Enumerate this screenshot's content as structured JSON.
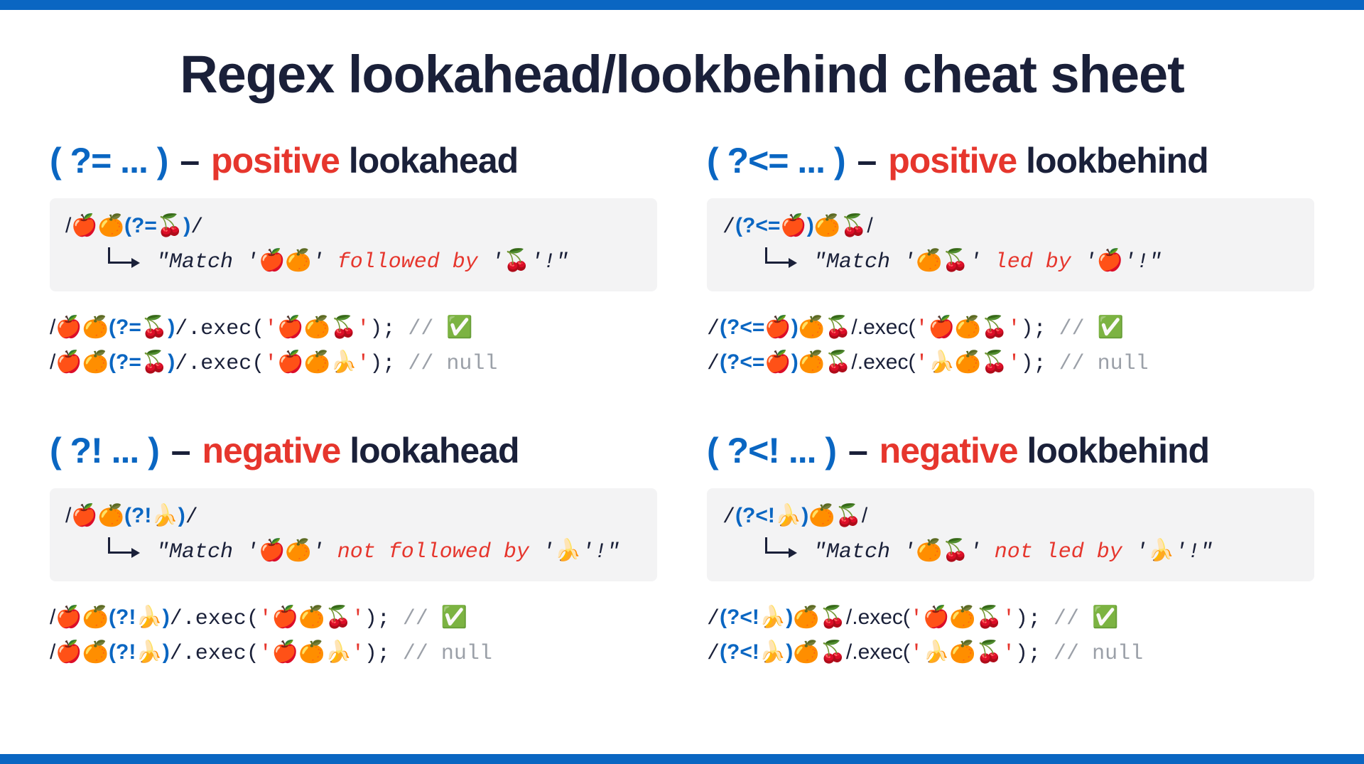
{
  "title": "Regex lookahead/lookbehind cheat sheet",
  "emoji": {
    "apple": "🍎",
    "orange": "🍊",
    "cherry": "🍒",
    "banana": "🍌",
    "check": "✅"
  },
  "panels": {
    "pos_ahead": {
      "syntax": "( ?= ... )",
      "dash": "–",
      "polarity": "positive",
      "kind": "lookahead",
      "pattern_pre": "/🍎🍊",
      "pattern_group": "(?=🍒)",
      "pattern_post": "/",
      "desc_pre": "\"Match '",
      "desc_subject": "🍎🍊",
      "desc_mid": "' ",
      "desc_condition": "followed by",
      "desc_post1": " '",
      "desc_target": "🍒",
      "desc_post2": "'!\"",
      "exec1": {
        "p_pre": "/🍎🍊",
        "p_group": "(?=🍒)",
        "p_post": "/.exec(",
        "arg_q1": "'",
        "arg_val": "🍎🍊🍒",
        "arg_q2": "'",
        "tail": "); ",
        "comment_pre": "// ",
        "comment_val": "✅"
      },
      "exec2": {
        "p_pre": "/🍎🍊",
        "p_group": "(?=🍒)",
        "p_post": "/.exec(",
        "arg_q1": "'",
        "arg_val": "🍎🍊🍌",
        "arg_q2": "'",
        "tail": "); ",
        "comment_pre": "// ",
        "comment_val": "null"
      }
    },
    "pos_behind": {
      "syntax": "( ?<= ... )",
      "dash": "–",
      "polarity": "positive",
      "kind": "lookbehind",
      "pattern_pre": "/",
      "pattern_group": "(?<=🍎)",
      "pattern_post": "🍊🍒/",
      "desc_pre": "\"Match '",
      "desc_subject": "🍊🍒",
      "desc_mid": "' ",
      "desc_condition": "led by",
      "desc_post1": " '",
      "desc_target": "🍎",
      "desc_post2": "'!\"",
      "exec1": {
        "p_pre": "/",
        "p_group": "(?<=🍎)",
        "p_post": "🍊🍒/.exec(",
        "arg_q1": "'",
        "arg_val": "🍎🍊🍒",
        "arg_q2": "'",
        "tail": "); ",
        "comment_pre": "// ",
        "comment_val": "✅"
      },
      "exec2": {
        "p_pre": "/",
        "p_group": "(?<=🍎)",
        "p_post": "🍊🍒/.exec(",
        "arg_q1": "'",
        "arg_val": "🍌🍊🍒",
        "arg_q2": "'",
        "tail": "); ",
        "comment_pre": "// ",
        "comment_val": "null"
      }
    },
    "neg_ahead": {
      "syntax": "( ?! ... )",
      "dash": "–",
      "polarity": "negative",
      "kind": "lookahead",
      "pattern_pre": "/🍎🍊",
      "pattern_group": "(?!🍌)",
      "pattern_post": "/",
      "desc_pre": "\"Match '",
      "desc_subject": "🍎🍊",
      "desc_mid": "' ",
      "desc_condition": "not followed by",
      "desc_post1": " '",
      "desc_target": "🍌",
      "desc_post2": "'!\"",
      "exec1": {
        "p_pre": "/🍎🍊",
        "p_group": "(?!🍌)",
        "p_post": "/.exec(",
        "arg_q1": "'",
        "arg_val": "🍎🍊🍒",
        "arg_q2": "'",
        "tail": "); ",
        "comment_pre": "// ",
        "comment_val": "✅"
      },
      "exec2": {
        "p_pre": "/🍎🍊",
        "p_group": "(?!🍌)",
        "p_post": "/.exec(",
        "arg_q1": "'",
        "arg_val": "🍎🍊🍌",
        "arg_q2": "'",
        "tail": "); ",
        "comment_pre": "// ",
        "comment_val": "null"
      }
    },
    "neg_behind": {
      "syntax": "( ?<! ... )",
      "dash": "–",
      "polarity": "negative",
      "kind": "lookbehind",
      "pattern_pre": "/",
      "pattern_group": "(?<!🍌)",
      "pattern_post": "🍊🍒/",
      "desc_pre": "\"Match '",
      "desc_subject": "🍊🍒",
      "desc_mid": "' ",
      "desc_condition": "not led by",
      "desc_post1": " '",
      "desc_target": "🍌",
      "desc_post2": "'!\"",
      "exec1": {
        "p_pre": "/",
        "p_group": "(?<!🍌)",
        "p_post": "🍊🍒/.exec(",
        "arg_q1": "'",
        "arg_val": "🍎🍊🍒",
        "arg_q2": "'",
        "tail": "); ",
        "comment_pre": "// ",
        "comment_val": "✅"
      },
      "exec2": {
        "p_pre": "/",
        "p_group": "(?<!🍌)",
        "p_post": "🍊🍒/.exec(",
        "arg_q1": "'",
        "arg_val": "🍌🍊🍒",
        "arg_q2": "'",
        "tail": "); ",
        "comment_pre": "// ",
        "comment_val": "null"
      }
    }
  }
}
